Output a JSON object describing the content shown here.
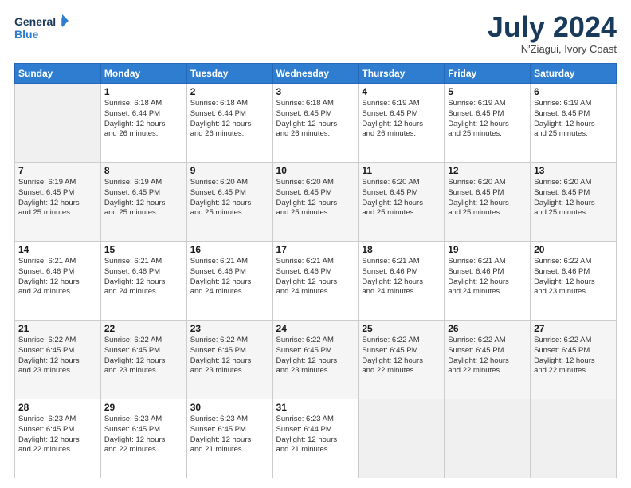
{
  "header": {
    "logo_line1": "General",
    "logo_line2": "Blue",
    "month": "July 2024",
    "location": "N'Ziagui, Ivory Coast"
  },
  "days_of_week": [
    "Sunday",
    "Monday",
    "Tuesday",
    "Wednesday",
    "Thursday",
    "Friday",
    "Saturday"
  ],
  "weeks": [
    [
      {
        "day": "",
        "info": ""
      },
      {
        "day": "1",
        "info": "Sunrise: 6:18 AM\nSunset: 6:44 PM\nDaylight: 12 hours\nand 26 minutes."
      },
      {
        "day": "2",
        "info": "Sunrise: 6:18 AM\nSunset: 6:44 PM\nDaylight: 12 hours\nand 26 minutes."
      },
      {
        "day": "3",
        "info": "Sunrise: 6:18 AM\nSunset: 6:45 PM\nDaylight: 12 hours\nand 26 minutes."
      },
      {
        "day": "4",
        "info": "Sunrise: 6:19 AM\nSunset: 6:45 PM\nDaylight: 12 hours\nand 26 minutes."
      },
      {
        "day": "5",
        "info": "Sunrise: 6:19 AM\nSunset: 6:45 PM\nDaylight: 12 hours\nand 25 minutes."
      },
      {
        "day": "6",
        "info": "Sunrise: 6:19 AM\nSunset: 6:45 PM\nDaylight: 12 hours\nand 25 minutes."
      }
    ],
    [
      {
        "day": "7",
        "info": "Sunrise: 6:19 AM\nSunset: 6:45 PM\nDaylight: 12 hours\nand 25 minutes."
      },
      {
        "day": "8",
        "info": "Sunrise: 6:19 AM\nSunset: 6:45 PM\nDaylight: 12 hours\nand 25 minutes."
      },
      {
        "day": "9",
        "info": "Sunrise: 6:20 AM\nSunset: 6:45 PM\nDaylight: 12 hours\nand 25 minutes."
      },
      {
        "day": "10",
        "info": "Sunrise: 6:20 AM\nSunset: 6:45 PM\nDaylight: 12 hours\nand 25 minutes."
      },
      {
        "day": "11",
        "info": "Sunrise: 6:20 AM\nSunset: 6:45 PM\nDaylight: 12 hours\nand 25 minutes."
      },
      {
        "day": "12",
        "info": "Sunrise: 6:20 AM\nSunset: 6:45 PM\nDaylight: 12 hours\nand 25 minutes."
      },
      {
        "day": "13",
        "info": "Sunrise: 6:20 AM\nSunset: 6:45 PM\nDaylight: 12 hours\nand 25 minutes."
      }
    ],
    [
      {
        "day": "14",
        "info": "Sunrise: 6:21 AM\nSunset: 6:46 PM\nDaylight: 12 hours\nand 24 minutes."
      },
      {
        "day": "15",
        "info": "Sunrise: 6:21 AM\nSunset: 6:46 PM\nDaylight: 12 hours\nand 24 minutes."
      },
      {
        "day": "16",
        "info": "Sunrise: 6:21 AM\nSunset: 6:46 PM\nDaylight: 12 hours\nand 24 minutes."
      },
      {
        "day": "17",
        "info": "Sunrise: 6:21 AM\nSunset: 6:46 PM\nDaylight: 12 hours\nand 24 minutes."
      },
      {
        "day": "18",
        "info": "Sunrise: 6:21 AM\nSunset: 6:46 PM\nDaylight: 12 hours\nand 24 minutes."
      },
      {
        "day": "19",
        "info": "Sunrise: 6:21 AM\nSunset: 6:46 PM\nDaylight: 12 hours\nand 24 minutes."
      },
      {
        "day": "20",
        "info": "Sunrise: 6:22 AM\nSunset: 6:46 PM\nDaylight: 12 hours\nand 23 minutes."
      }
    ],
    [
      {
        "day": "21",
        "info": "Sunrise: 6:22 AM\nSunset: 6:45 PM\nDaylight: 12 hours\nand 23 minutes."
      },
      {
        "day": "22",
        "info": "Sunrise: 6:22 AM\nSunset: 6:45 PM\nDaylight: 12 hours\nand 23 minutes."
      },
      {
        "day": "23",
        "info": "Sunrise: 6:22 AM\nSunset: 6:45 PM\nDaylight: 12 hours\nand 23 minutes."
      },
      {
        "day": "24",
        "info": "Sunrise: 6:22 AM\nSunset: 6:45 PM\nDaylight: 12 hours\nand 23 minutes."
      },
      {
        "day": "25",
        "info": "Sunrise: 6:22 AM\nSunset: 6:45 PM\nDaylight: 12 hours\nand 22 minutes."
      },
      {
        "day": "26",
        "info": "Sunrise: 6:22 AM\nSunset: 6:45 PM\nDaylight: 12 hours\nand 22 minutes."
      },
      {
        "day": "27",
        "info": "Sunrise: 6:22 AM\nSunset: 6:45 PM\nDaylight: 12 hours\nand 22 minutes."
      }
    ],
    [
      {
        "day": "28",
        "info": "Sunrise: 6:23 AM\nSunset: 6:45 PM\nDaylight: 12 hours\nand 22 minutes."
      },
      {
        "day": "29",
        "info": "Sunrise: 6:23 AM\nSunset: 6:45 PM\nDaylight: 12 hours\nand 22 minutes."
      },
      {
        "day": "30",
        "info": "Sunrise: 6:23 AM\nSunset: 6:45 PM\nDaylight: 12 hours\nand 21 minutes."
      },
      {
        "day": "31",
        "info": "Sunrise: 6:23 AM\nSunset: 6:44 PM\nDaylight: 12 hours\nand 21 minutes."
      },
      {
        "day": "",
        "info": ""
      },
      {
        "day": "",
        "info": ""
      },
      {
        "day": "",
        "info": ""
      }
    ]
  ]
}
